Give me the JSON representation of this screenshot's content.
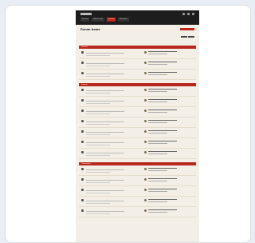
{
  "window": {
    "title": ""
  },
  "topbar": {
    "nav": [
      "Forums",
      "What's new",
      "Forums",
      "Members"
    ]
  },
  "header": {
    "title": "Forum home",
    "subtitle": "",
    "cta_label": ""
  },
  "sections": [
    {
      "title": "General",
      "rows": 3
    },
    {
      "title": "Support",
      "rows": 7
    },
    {
      "title": "Community",
      "rows": 5
    }
  ],
  "colors": {
    "accent": "#c0271b",
    "topbar": "#1d1d1d",
    "page": "#f3efe6"
  }
}
